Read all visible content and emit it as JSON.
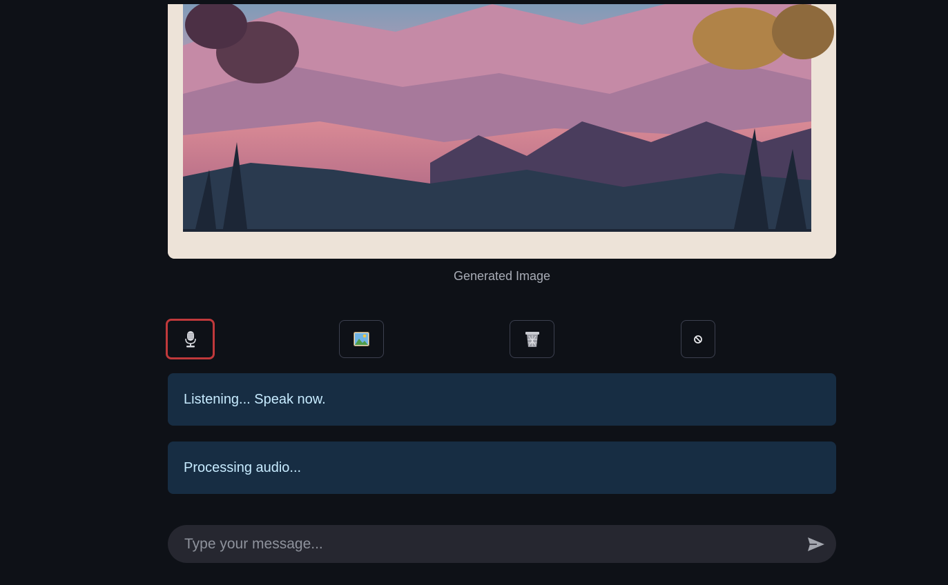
{
  "generated_image": {
    "caption": "Generated Image",
    "description": "pink mountain valley landscape with silhouetted pine trees and autumn foliage"
  },
  "toolbar": {
    "buttons": [
      {
        "icon": "microphone-icon",
        "state": "active"
      },
      {
        "icon": "image-icon",
        "state": "normal"
      },
      {
        "icon": "trash-icon",
        "state": "normal"
      },
      {
        "icon": "stop-icon",
        "state": "normal"
      }
    ]
  },
  "status_messages": [
    "Listening... Speak now.",
    "Processing audio..."
  ],
  "chat_input": {
    "placeholder": "Type your message...",
    "value": ""
  },
  "colors": {
    "background": "#0e1117",
    "status_bg": "#172d43",
    "status_text": "#c7ebff",
    "active_border": "#c0393b",
    "input_bg": "#262730"
  }
}
